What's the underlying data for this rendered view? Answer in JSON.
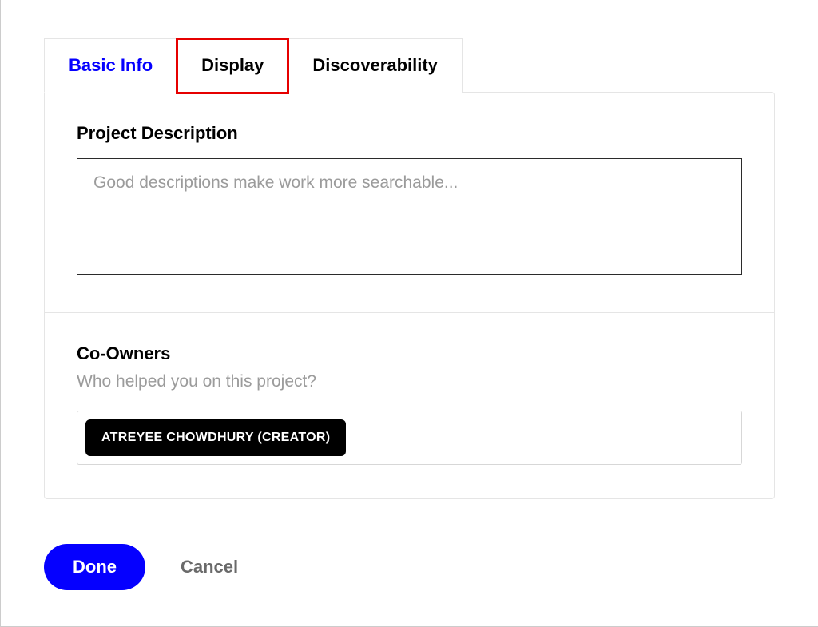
{
  "tabs": {
    "basic_info": "Basic Info",
    "display": "Display",
    "discoverability": "Discoverability"
  },
  "description": {
    "label": "Project Description",
    "placeholder": "Good descriptions make work more searchable...",
    "value": ""
  },
  "coowners": {
    "label": "Co-Owners",
    "subtitle": "Who helped you on this project?",
    "chips": [
      "ATREYEE CHOWDHURY (CREATOR)"
    ]
  },
  "footer": {
    "done": "Done",
    "cancel": "Cancel"
  }
}
